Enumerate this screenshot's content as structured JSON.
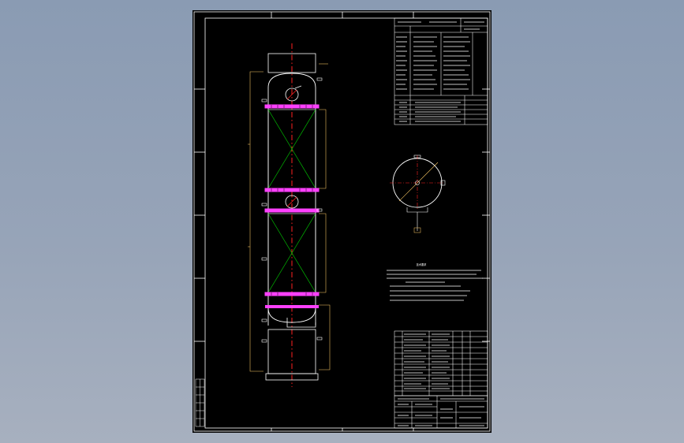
{
  "drawing": {
    "title_block": {
      "company": "",
      "drawing_name": "",
      "drawing_number": "",
      "scale": "",
      "sheet": ""
    },
    "technical_notes_title": "技术要求",
    "colors": {
      "background": "#000000",
      "frame": "#ffffff",
      "centerline": "#ff2020",
      "vessel_outline": "#ffffff",
      "packing_diagonal": "#00c000",
      "flange": "#ff40ff",
      "dimension": "#ffcc66",
      "table_lines": "#ffffff"
    }
  }
}
